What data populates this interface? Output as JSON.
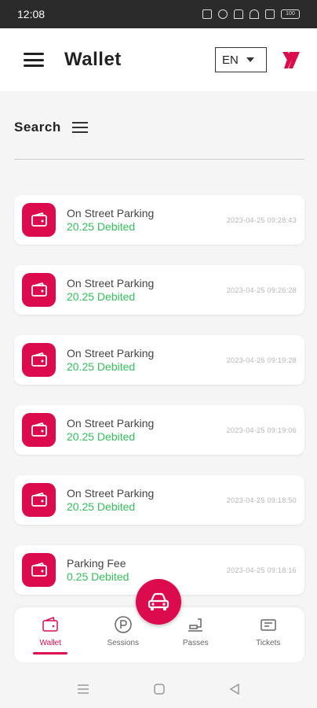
{
  "status_bar": {
    "time": "12:08",
    "battery": "100"
  },
  "header": {
    "title": "Wallet",
    "language": "EN"
  },
  "search": {
    "label": "Search"
  },
  "transactions": [
    {
      "title": "On Street Parking",
      "amount": "20.25 Debited",
      "date": "2023-04-25 09:28:43"
    },
    {
      "title": "On Street Parking",
      "amount": "20.25 Debited",
      "date": "2023-04-25 09:26:28"
    },
    {
      "title": "On Street Parking",
      "amount": "20.25 Debited",
      "date": "2023-04-25 09:19:28"
    },
    {
      "title": "On Street Parking",
      "amount": "20.25 Debited",
      "date": "2023-04-25 09:19:06"
    },
    {
      "title": "On Street Parking",
      "amount": "20.25 Debited",
      "date": "2023-04-25 09:18:50"
    },
    {
      "title": "Parking Fee",
      "amount": "0.25 Debited",
      "date": "2023-04-25 09:18:16"
    }
  ],
  "bottom_nav": [
    {
      "label": "Wallet",
      "icon": "wallet-icon",
      "active": true
    },
    {
      "label": "Sessions",
      "icon": "parking-icon",
      "active": false
    },
    {
      "label": "Passes",
      "icon": "pass-icon",
      "active": false
    },
    {
      "label": "Tickets",
      "icon": "ticket-icon",
      "active": false
    }
  ],
  "colors": {
    "accent": "#dc0b4e",
    "debit": "#33c05a",
    "date": "#b5b5b5"
  }
}
